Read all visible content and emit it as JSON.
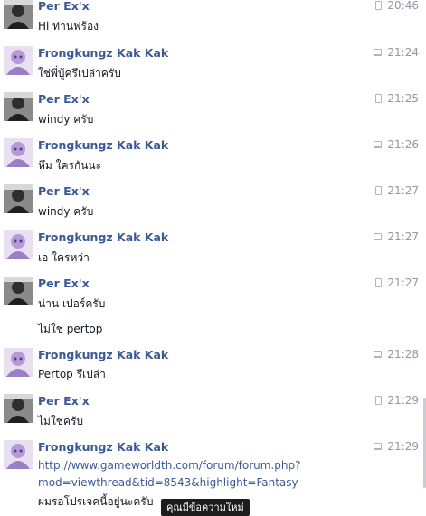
{
  "messages": [
    {
      "sender": "Per Ex'x",
      "time": "20:46",
      "device": "mobile",
      "lines": [
        "Hi ท่านฟร้อง"
      ]
    },
    {
      "sender": "Frongkungz Kak Kak",
      "time": "21:24",
      "device": "desktop",
      "lines": [
        "ใช่พี่บู้ครึเปล่าครับ"
      ]
    },
    {
      "sender": "Per Ex'x",
      "time": "21:25",
      "device": "mobile",
      "lines": [
        "windy ครับ"
      ]
    },
    {
      "sender": "Frongkungz Kak Kak",
      "time": "21:26",
      "device": "desktop",
      "lines": [
        "หึม ใครกันนะ"
      ]
    },
    {
      "sender": "Per Ex'x",
      "time": "21:27",
      "device": "mobile",
      "lines": [
        "windy ครับ"
      ]
    },
    {
      "sender": "Frongkungz Kak Kak",
      "time": "21:27",
      "device": "desktop",
      "lines": [
        "เอ ใครหว่า"
      ]
    },
    {
      "sender": "Per Ex'x",
      "time": "21:27",
      "device": "mobile",
      "lines": [
        "น่าน เปอร์ครับ",
        "ไม่ใช่ pertop"
      ]
    },
    {
      "sender": "Frongkungz Kak Kak",
      "time": "21:28",
      "device": "desktop",
      "lines": [
        "Pertop รึเปล่า"
      ]
    },
    {
      "sender": "Per Ex'x",
      "time": "21:29",
      "device": "mobile",
      "lines": [
        "ไม่ใช่ครับ"
      ]
    },
    {
      "sender": "Frongkungz Kak Kak",
      "time": "21:29",
      "device": "desktop",
      "link_lines": [
        "http://www.gameworldth.com/forum/forum.php?",
        "mod=viewthread&tid=8543&highlight=Fantasy"
      ],
      "lines": [
        "ผมรอโปรเจคนี้อยู่นะครับ"
      ]
    }
  ],
  "tooltip": "คุณมีข้อความใหม่"
}
